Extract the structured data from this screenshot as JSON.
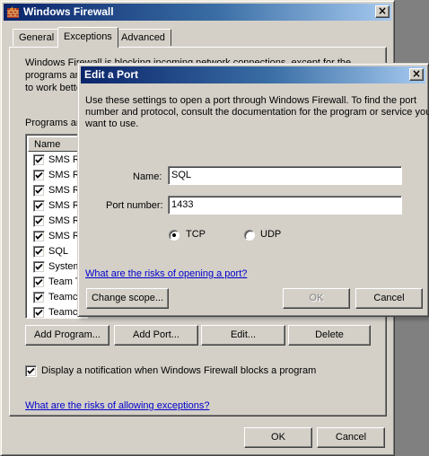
{
  "main_window": {
    "title": "Windows Firewall",
    "tabs": [
      {
        "label": "General",
        "active": false
      },
      {
        "label": "Exceptions",
        "active": true
      },
      {
        "label": "Advanced",
        "active": false
      }
    ],
    "intro_text": {
      "line1": "Windows Firewall is blocking incoming network connections, except for the",
      "line2": "programs an",
      "line3": "to work bette"
    },
    "programs_label": "Programs an",
    "list": {
      "column_header": "Name",
      "items": [
        {
          "label": "SMS R",
          "checked": true
        },
        {
          "label": "SMS R",
          "checked": true
        },
        {
          "label": "SMS R",
          "checked": true
        },
        {
          "label": "SMS R",
          "checked": true
        },
        {
          "label": "SMS R",
          "checked": true
        },
        {
          "label": "SMS R",
          "checked": true
        },
        {
          "label": "SQL",
          "checked": true
        },
        {
          "label": "System",
          "checked": true
        },
        {
          "label": "Team T",
          "checked": true
        },
        {
          "label": "Teamc",
          "checked": true
        },
        {
          "label": "Teamc",
          "checked": true
        }
      ]
    },
    "buttons": {
      "add_program": "Add Program...",
      "add_port": "Add Port...",
      "edit": "Edit...",
      "delete": "Delete"
    },
    "notification_checkbox": {
      "label": "Display a notification when Windows Firewall blocks a program",
      "checked": true
    },
    "risks_link": "What are the risks of allowing exceptions?",
    "ok": "OK",
    "cancel": "Cancel"
  },
  "dialog": {
    "title": "Edit a Port",
    "description": {
      "line1": "Use these settings to open a port through Windows Firewall. To find the port",
      "line2": "number and protocol, consult the documentation for the program or service you",
      "line3": "want to use."
    },
    "name_label": "Name:",
    "name_value": "SQL",
    "port_label": "Port number:",
    "port_value": "1433",
    "protocol": {
      "tcp_label": "TCP",
      "udp_label": "UDP",
      "selected": "TCP"
    },
    "risks_link": "What are the risks of opening a port?",
    "change_scope": "Change scope...",
    "ok": "OK",
    "cancel": "Cancel"
  },
  "colors": {
    "face": "#d4d0c8",
    "title_active_start": "#0a246a",
    "title_active_end": "#a6caf0",
    "link": "#0000cc"
  }
}
